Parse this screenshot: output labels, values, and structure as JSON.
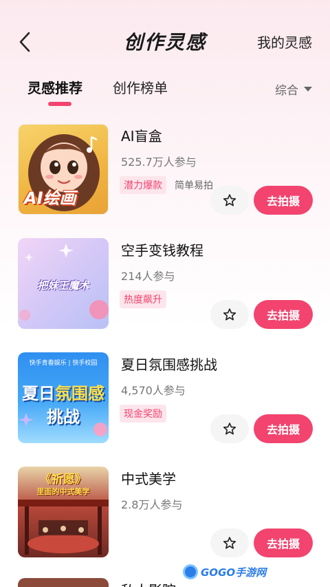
{
  "header": {
    "title": "创作灵感",
    "right_link": "我的灵感"
  },
  "tabs": {
    "active": "灵感推荐",
    "inactive": "创作榜单",
    "sort": "综合"
  },
  "items": [
    {
      "title": "AI盲盒",
      "count": "525.7万人参与",
      "tags": [
        "潜力爆款",
        "简单易拍"
      ],
      "thumb_text": "AI绘画",
      "button": "去拍摄"
    },
    {
      "title": "空手变钱教程",
      "count": "214人参与",
      "tags": [
        "热度飙升"
      ],
      "thumb_text": "把妹王魔术",
      "button": "去拍摄"
    },
    {
      "title": "夏日氛围感挑战",
      "count": "4,570人参与",
      "tags": [
        "现金奖励"
      ],
      "thumb_top": "快手青春娱乐 | 快手校园",
      "thumb_line1a": "夏日",
      "thumb_line1b": "氛围感",
      "thumb_line2": "挑战",
      "button": "去拍摄"
    },
    {
      "title": "中式美学",
      "count": "2.8万人参与",
      "tags": [],
      "thumb_top": "《祈愿》",
      "thumb_sub": "里面的中式美学",
      "button": "去拍摄"
    },
    {
      "title": "私人影院"
    }
  ],
  "watermark": "GOGO手游网",
  "colors": {
    "accent": "#f2446e",
    "tag_bg": "#fde5ec"
  }
}
